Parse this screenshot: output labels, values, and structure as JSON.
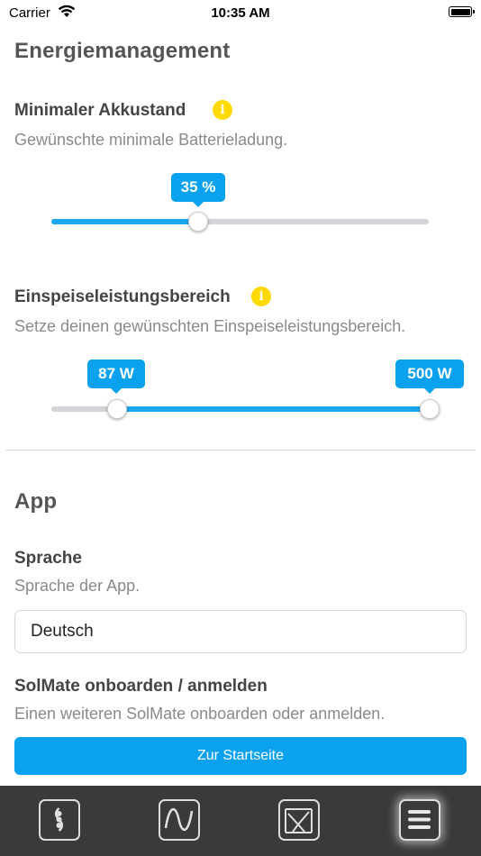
{
  "status_bar": {
    "carrier": "Carrier",
    "time": "10:35 AM"
  },
  "energy": {
    "title": "Energiemanagement",
    "min_battery": {
      "label": "Minimaler Akkustand",
      "description": "Gewünschte minimale Batterieladung.",
      "value_label": "35 %",
      "value": 0.35
    },
    "feed_in": {
      "label": "Einspeiseleistungsbereich",
      "description": "Setze deinen gewünschten Einspeiseleistungsbereich.",
      "min_label": "87 W",
      "max_label": "500 W",
      "min_value": 87,
      "max_value": 500
    }
  },
  "app": {
    "title": "App",
    "language": {
      "label": "Sprache",
      "description": "Sprache der App.",
      "selected": "Deutsch"
    },
    "onboard": {
      "label": "SolMate onboarden / anmelden",
      "description": "Einen weiteren SolMate onboarden oder anmelden.",
      "button": "Zur Startseite"
    }
  },
  "tabbar": {
    "tabs": [
      {
        "icon": "device-icon",
        "active": false
      },
      {
        "icon": "wave-chart-icon",
        "active": false
      },
      {
        "icon": "sun-panel-icon",
        "active": false
      },
      {
        "icon": "menu-icon",
        "active": true
      }
    ]
  },
  "colors": {
    "accent": "#0aa2ef",
    "info": "#ffd900",
    "tabbar": "#3a3a3a"
  }
}
